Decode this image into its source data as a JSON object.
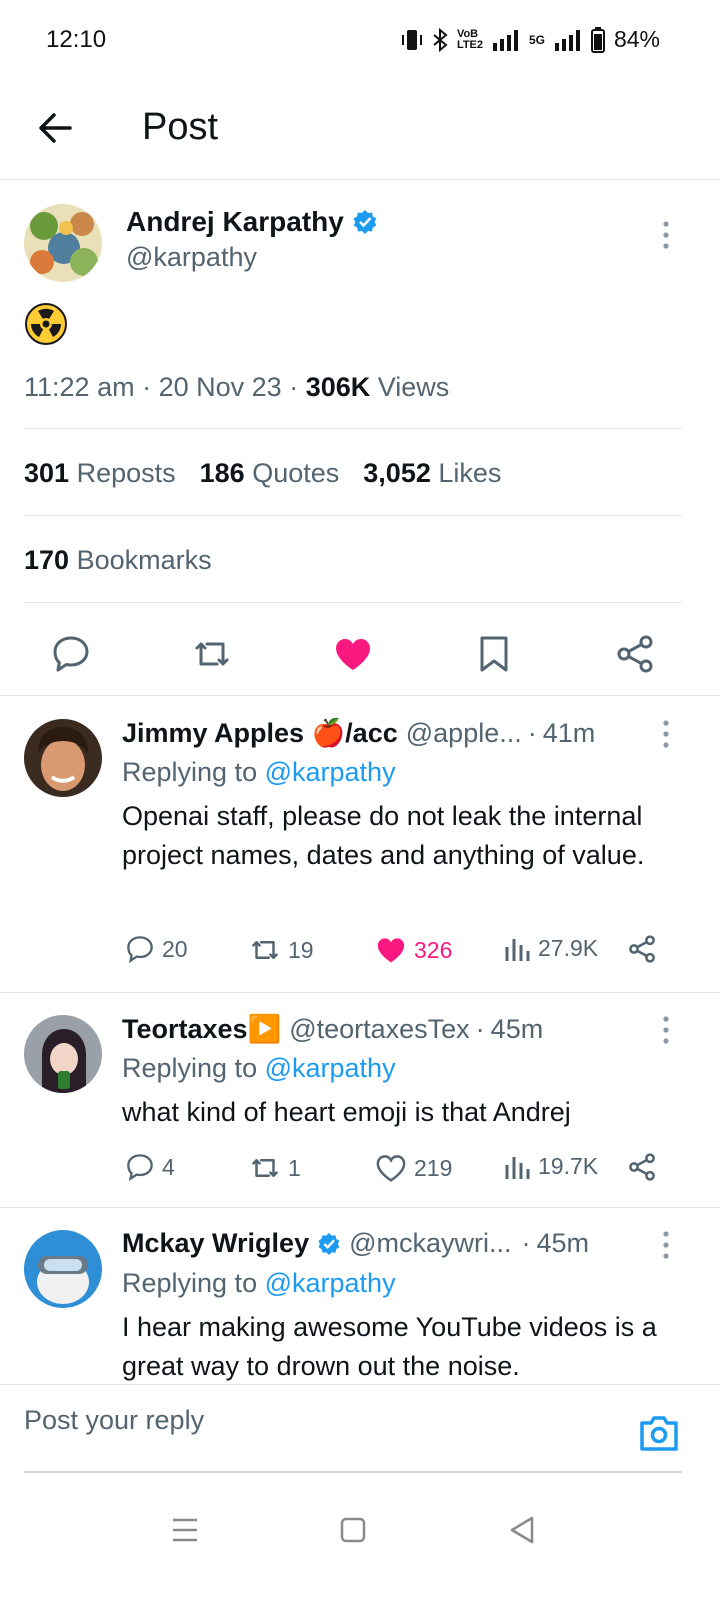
{
  "status_bar": {
    "time": "12:10",
    "network_1": "VoB LTE2",
    "network_2": "5G",
    "battery": "84%"
  },
  "header": {
    "title": "Post"
  },
  "post": {
    "author_name": "Andrej Karpathy",
    "author_handle": "@karpathy",
    "emoji": "radioactive-emoji",
    "time": "11:22 am",
    "date": "20 Nov 23",
    "views_count": "306K",
    "views_label": "Views",
    "reposts_count": "301",
    "reposts_label": "Reposts",
    "quotes_count": "186",
    "quotes_label": "Quotes",
    "likes_count": "3,052",
    "likes_label": "Likes",
    "bookmarks_count": "170",
    "bookmarks_label": "Bookmarks"
  },
  "replies": [
    {
      "name": "Jimmy Apples 🍎/acc",
      "handle": "@apple...",
      "time": "41m",
      "replying_prefix": "Replying to",
      "replying_to": "@karpathy",
      "text": "Openai staff, please do not leak the internal project names, dates and anything of value.",
      "comments": "20",
      "reposts": "19",
      "likes": "326",
      "views": "27.9K",
      "liked": true
    },
    {
      "name": "Teortaxes▶️",
      "handle": "@teortaxesTex",
      "time": "45m",
      "replying_prefix": "Replying to",
      "replying_to": "@karpathy",
      "text": "what kind of heart emoji is that Andrej",
      "comments": "4",
      "reposts": "1",
      "likes": "219",
      "views": "19.7K",
      "liked": false
    },
    {
      "name": "Mckay Wrigley",
      "handle": "@mckaywri...",
      "time": "45m",
      "replying_prefix": "Replying to",
      "replying_to": "@karpathy",
      "text": "I hear making awesome YouTube videos is a great way to drown out the noise."
    }
  ],
  "reply_box": {
    "placeholder": "Post your reply"
  },
  "colors": {
    "accent": "#1d9bf0",
    "like": "#f91880",
    "text": "#0f1419",
    "muted": "#536471"
  }
}
